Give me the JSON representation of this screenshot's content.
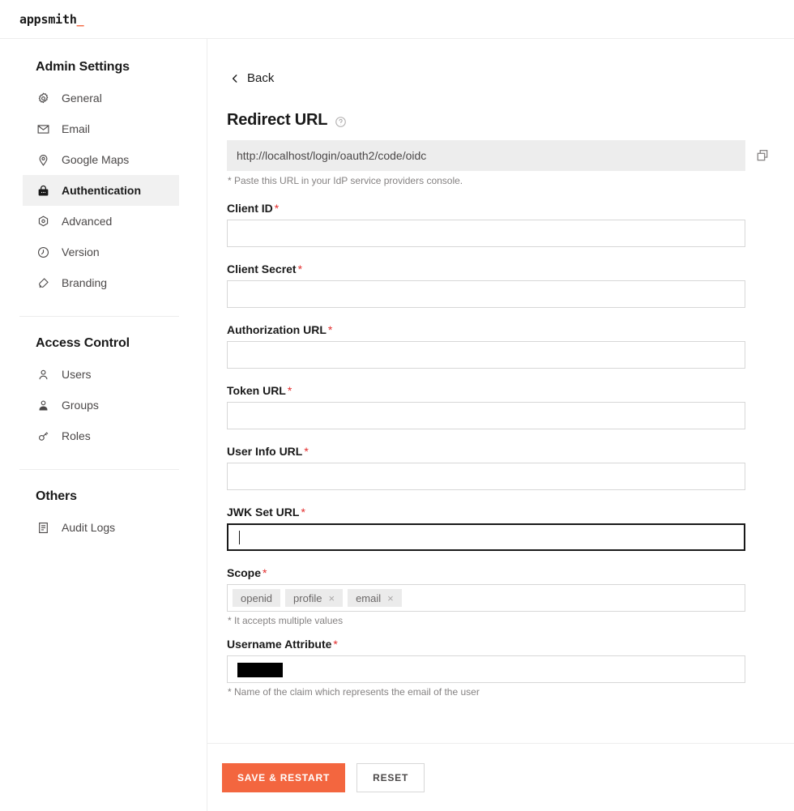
{
  "header": {
    "logo_text": "appsmith",
    "logo_tail": "_"
  },
  "sidebar": {
    "groups": [
      {
        "title": "Admin Settings",
        "items": [
          {
            "label": "General",
            "icon": "gear-icon",
            "active": false
          },
          {
            "label": "Email",
            "icon": "envelope-icon",
            "active": false
          },
          {
            "label": "Google Maps",
            "icon": "map-pin-icon",
            "active": false
          },
          {
            "label": "Authentication",
            "icon": "lock-icon",
            "active": true
          },
          {
            "label": "Advanced",
            "icon": "hexagon-dot-icon",
            "active": false
          },
          {
            "label": "Version",
            "icon": "clock-icon",
            "active": false
          },
          {
            "label": "Branding",
            "icon": "paint-icon",
            "active": false
          }
        ]
      },
      {
        "title": "Access Control",
        "items": [
          {
            "label": "Users",
            "icon": "user-icon",
            "active": false
          },
          {
            "label": "Groups",
            "icon": "group-icon",
            "active": false
          },
          {
            "label": "Roles",
            "icon": "key-icon",
            "active": false
          }
        ]
      },
      {
        "title": "Others",
        "items": [
          {
            "label": "Audit Logs",
            "icon": "document-list-icon",
            "active": false
          }
        ]
      }
    ]
  },
  "main": {
    "back_label": "Back",
    "page_title": "Redirect URL",
    "redirect_url_value": "http://localhost/login/oauth2/code/oidc",
    "redirect_url_hint": "* Paste this URL in your IdP service providers console.",
    "fields": [
      {
        "label": "Client ID",
        "required": "*",
        "value": ""
      },
      {
        "label": "Client Secret",
        "required": "*",
        "value": ""
      },
      {
        "label": "Authorization URL",
        "required": "*",
        "value": ""
      },
      {
        "label": "Token URL",
        "required": "*",
        "value": ""
      },
      {
        "label": "User Info URL",
        "required": "*",
        "value": ""
      }
    ],
    "jwk": {
      "label": "JWK Set URL",
      "required": "*",
      "value": ""
    },
    "scope": {
      "label": "Scope",
      "required": "*",
      "tags": [
        {
          "text": "openid",
          "removable": false,
          "remove_glyph": ""
        },
        {
          "text": "profile",
          "removable": true,
          "remove_glyph": "×"
        },
        {
          "text": "email",
          "removable": true,
          "remove_glyph": "×"
        }
      ],
      "hint": "* It accepts multiple values"
    },
    "username_attribute": {
      "label": "Username Attribute",
      "required": "*",
      "value_redacted": true,
      "hint": "* Name of the claim which represents the email of the user"
    }
  },
  "footer": {
    "save_label": "SAVE & RESTART",
    "reset_label": "RESET"
  },
  "colors": {
    "accent": "#f3663f",
    "required": "#e22c2c",
    "active_nav_bg": "#f1f1f1",
    "readonly_bg": "#ededed",
    "tag_bg": "#ebebeb"
  }
}
